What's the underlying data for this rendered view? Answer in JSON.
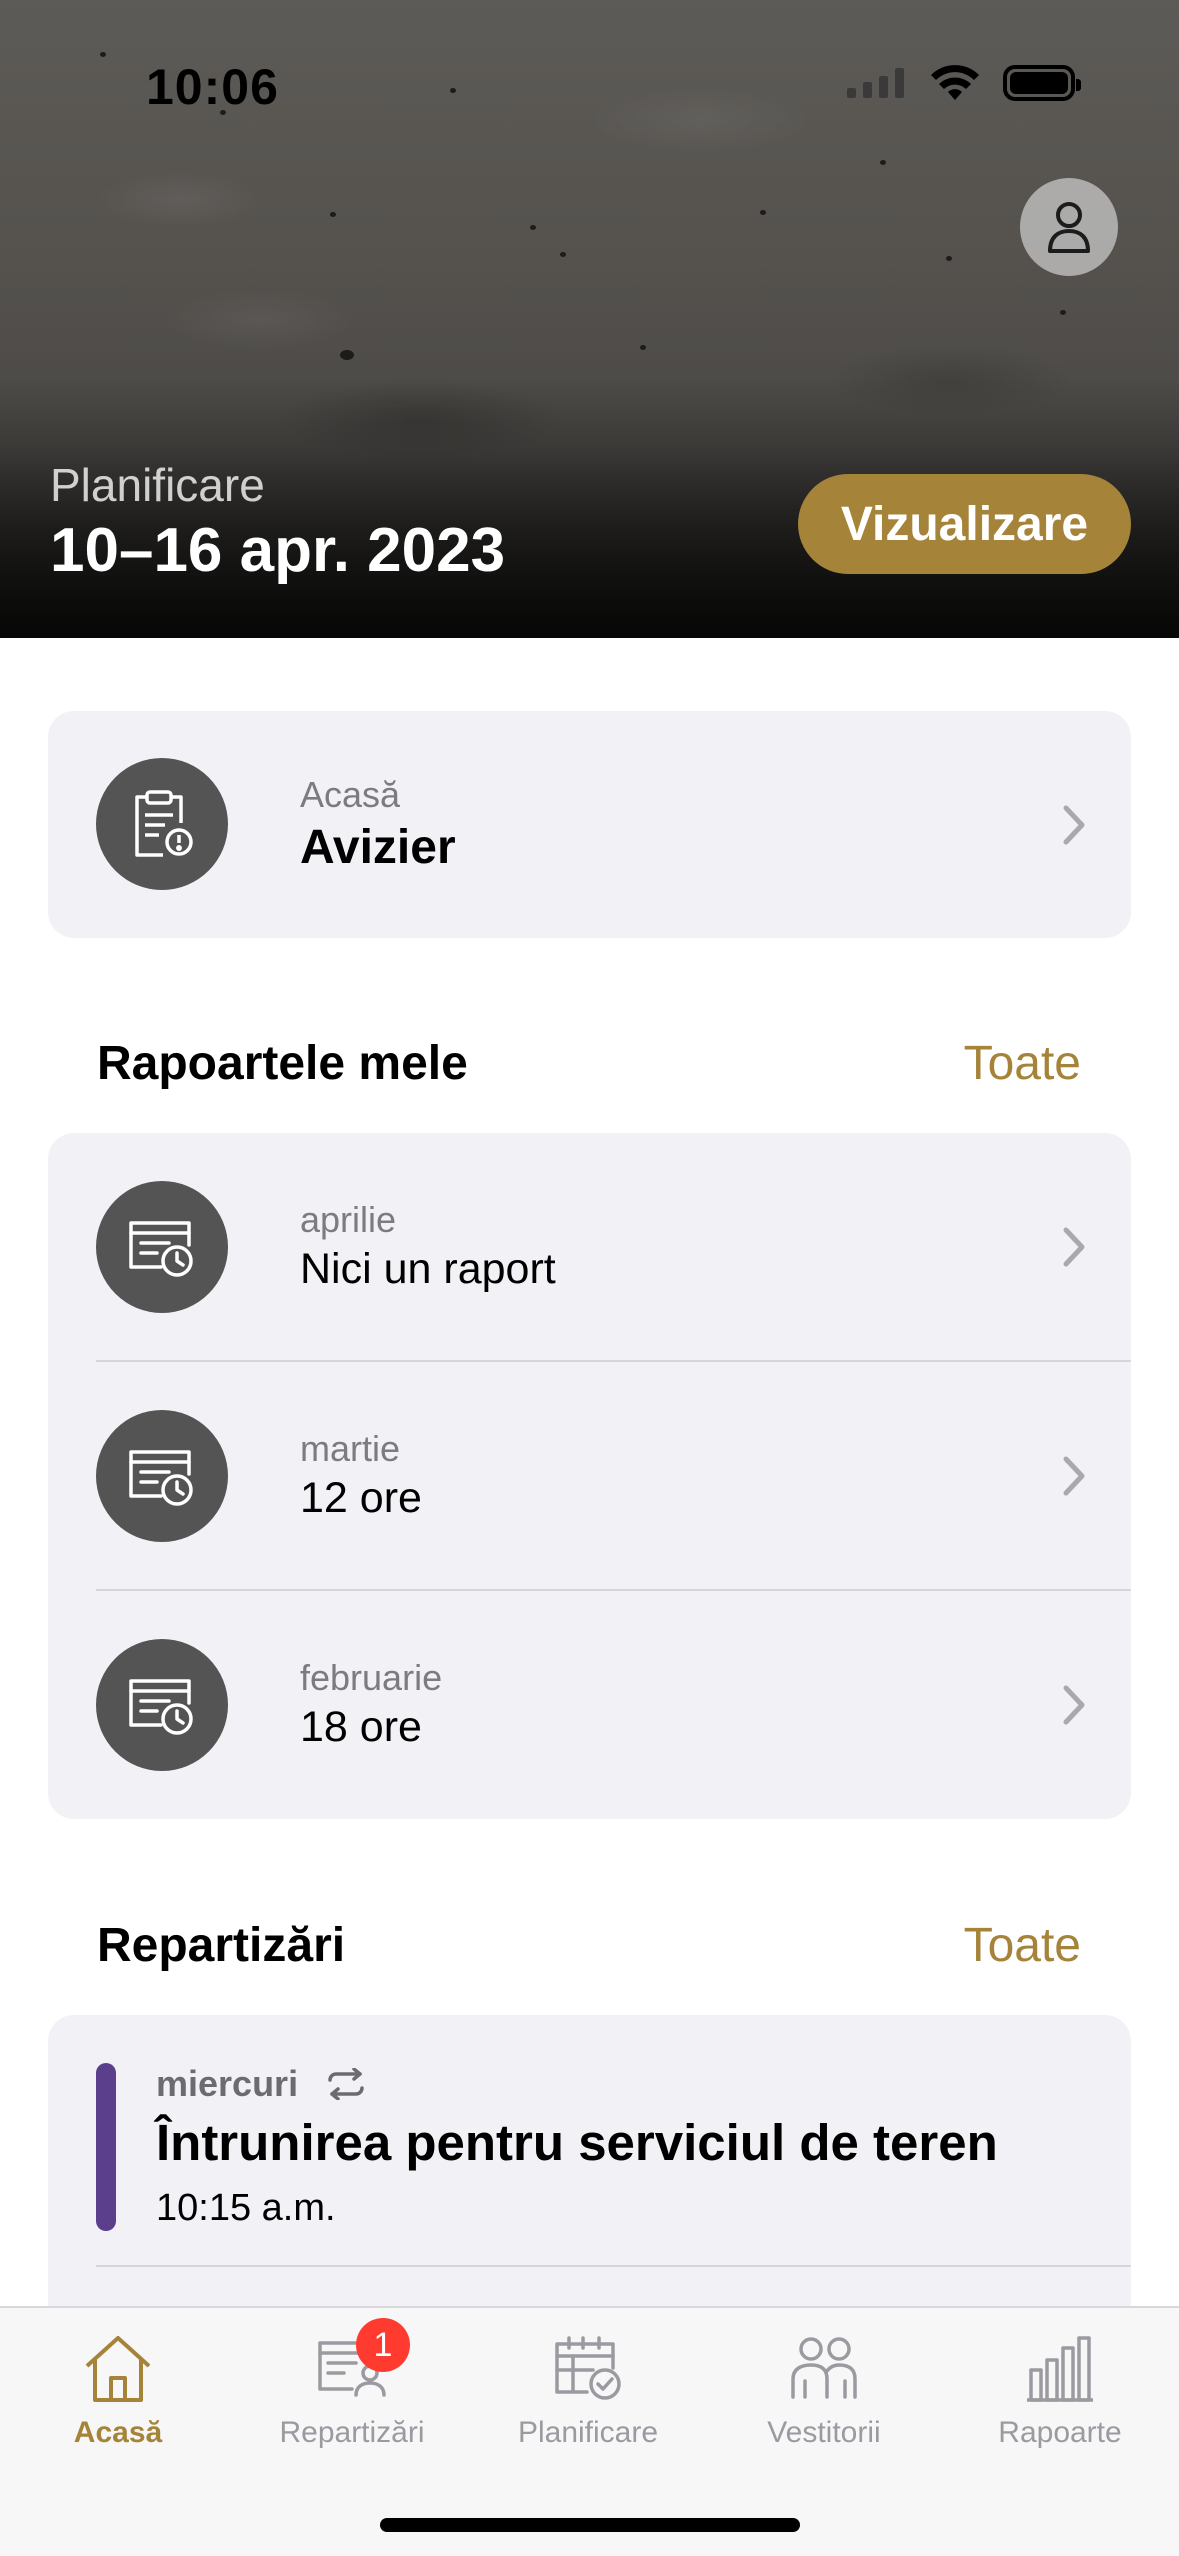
{
  "status_bar": {
    "time": "10:06"
  },
  "hero": {
    "label": "Planificare",
    "date": "10–16 apr. 2023",
    "button_label": "Vizualizare",
    "profile_icon": "person-icon"
  },
  "bulletin": {
    "small": "Acasă",
    "title": "Avizier",
    "icon": "clipboard-alert-icon"
  },
  "reports": {
    "title": "Rapoartele mele",
    "link": "Toate",
    "items": [
      {
        "month": "aprilie",
        "value": "Nici un raport"
      },
      {
        "month": "martie",
        "value": "12 ore"
      },
      {
        "month": "februarie",
        "value": "18 ore"
      }
    ]
  },
  "assignments": {
    "title": "Repartizări",
    "link": "Toate",
    "items": [
      {
        "day": "miercuri",
        "title": "Întrunirea pentru serviciul de teren",
        "time": "10:15 a.m.",
        "color": "#5b3e8c"
      }
    ]
  },
  "tabbar": {
    "tabs": [
      {
        "label": "Acasă",
        "icon": "house-icon",
        "active": true
      },
      {
        "label": "Repartizări",
        "icon": "assignments-icon",
        "badge": "1"
      },
      {
        "label": "Planificare",
        "icon": "calendar-check-icon"
      },
      {
        "label": "Vestitorii",
        "icon": "people-icon"
      },
      {
        "label": "Rapoarte",
        "icon": "bar-chart-icon"
      }
    ]
  },
  "colors": {
    "accent": "#a5843a",
    "badge": "#ff3b30",
    "card_bg": "#f2f2f6"
  }
}
